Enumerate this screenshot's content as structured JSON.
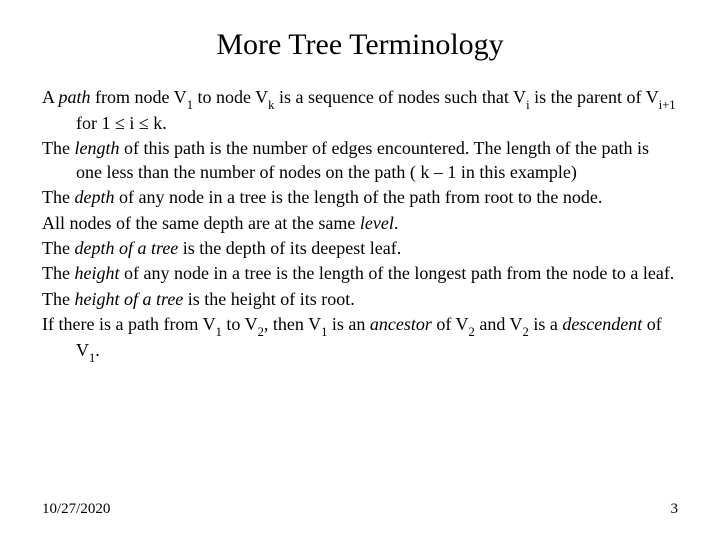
{
  "title": "More Tree Terminology",
  "p1a": "A ",
  "p1_path": "path",
  "p1b": " from node V",
  "p1c": " to node V",
  "p1d": " is a sequence of nodes such that V",
  "p1e": " is the parent of V",
  "p1f": " for 1 ≤ i ≤ k.",
  "sub_1": "1",
  "sub_k": "k",
  "sub_i": "i",
  "sub_ip1": "i+1",
  "p2a": "The ",
  "p2_len": "length",
  "p2b": " of this path is the number of edges encountered.  The length of the path is one less than the number of nodes on the path ( k – 1 in this example)",
  "p3a": "The ",
  "p3_depth": "depth",
  "p3b": " of any node in a tree is the length of the path from root to the node.",
  "p4a": "All nodes of the same depth are at the same ",
  "p4_level": "level",
  "p4b": ".",
  "p5a": "The ",
  "p5_dt": "depth of a tree",
  "p5b": " is the depth of its deepest leaf.",
  "p6a": "The ",
  "p6_h": "height",
  "p6b": " of any node in a tree is the length of the longest path from the node to a leaf.",
  "p7a": "The ",
  "p7_ht": "height of a tree",
  "p7b": " is the height of its root.",
  "p8a": "If there is a path from V",
  "p8b": " to V",
  "p8c": ", then V",
  "p8d": " is an ",
  "p8_anc": "ancestor",
  "p8e": " of V",
  "p8f": " and V",
  "p8g": " is a ",
  "p8_desc": "descendent",
  "p8h": " of V",
  "p8i": ".",
  "sub_2": "2",
  "footer_date": "10/27/2020",
  "footer_page": "3"
}
